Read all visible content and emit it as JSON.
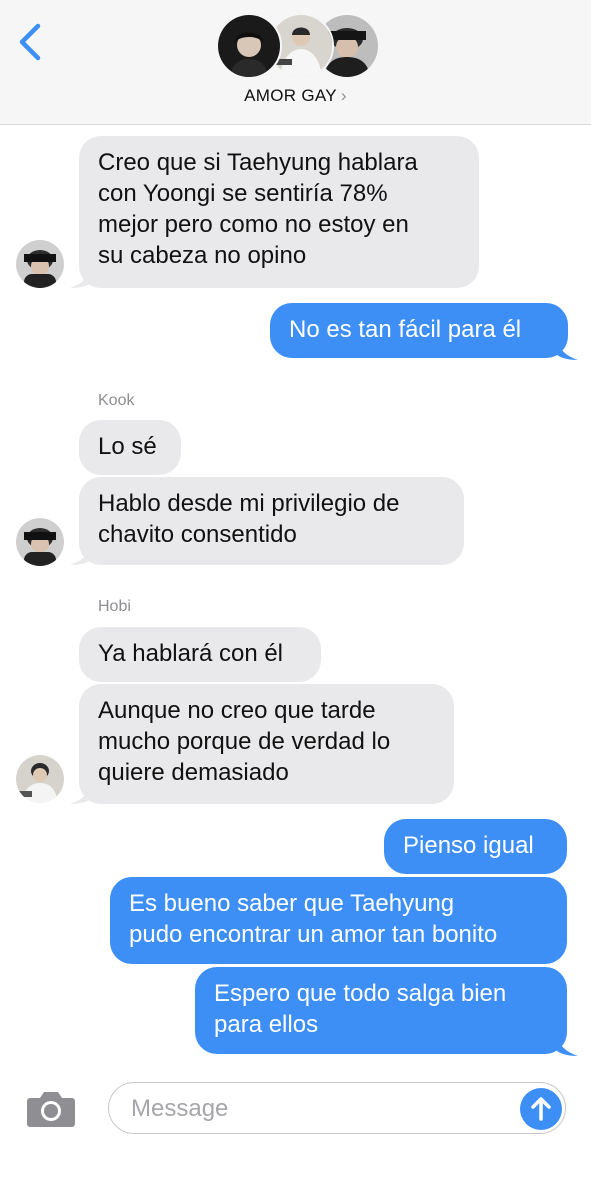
{
  "header": {
    "title": "AMOR GAY",
    "chevron": "›",
    "back_icon": "chevron-left-icon"
  },
  "colors": {
    "outgoing": "#3d8ff6",
    "incoming": "#e9e9eb",
    "header_bg": "#f6f6f6"
  },
  "thread": {
    "cut_label": "Kook",
    "messages": [
      {
        "dir": "in",
        "lines": [
          "Creo que si Taehyung hablara",
          "con Yoongi se sentiría 78%",
          "mejor pero como no estoy en",
          "su cabeza no opino"
        ]
      },
      {
        "dir": "out",
        "lines": [
          "No es tan fácil para él"
        ]
      },
      {
        "sender": "Kook"
      },
      {
        "dir": "in",
        "lines": [
          "Lo sé"
        ]
      },
      {
        "dir": "in",
        "lines": [
          "Hablo desde mi privilegio de",
          "chavito consentido"
        ]
      },
      {
        "sender": "Hobi"
      },
      {
        "dir": "in",
        "lines": [
          "Ya hablará con él"
        ]
      },
      {
        "dir": "in",
        "lines": [
          "Aunque no creo que tarde",
          "mucho porque de verdad lo",
          "quiere demasiado"
        ]
      },
      {
        "dir": "out",
        "lines": [
          "Pienso igual"
        ]
      },
      {
        "dir": "out",
        "lines": [
          "Es bueno saber que Taehyung",
          "pudo encontrar un amor tan bonito"
        ]
      },
      {
        "dir": "out",
        "lines": [
          "Espero que todo salga bien",
          "para ellos"
        ]
      }
    ]
  },
  "composer": {
    "placeholder": "Message",
    "camera_icon": "camera-icon",
    "send_icon": "arrow-up-icon"
  }
}
